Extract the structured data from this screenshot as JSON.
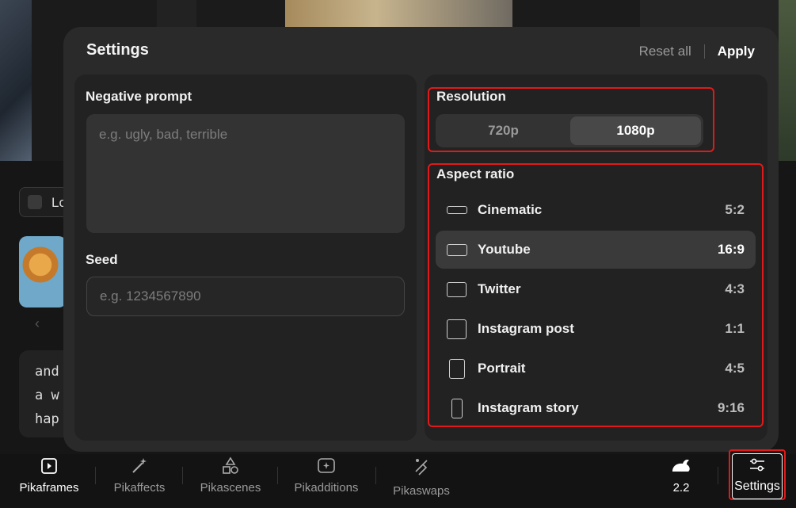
{
  "background": {
    "loop_label": "Lo",
    "prompt_lines": [
      "and",
      "a w",
      "hap"
    ]
  },
  "settings": {
    "title": "Settings",
    "reset_label": "Reset all",
    "apply_label": "Apply",
    "negative_prompt": {
      "label": "Negative prompt",
      "placeholder": "e.g. ugly, bad, terrible",
      "value": ""
    },
    "seed": {
      "label": "Seed",
      "placeholder": "e.g. 1234567890",
      "value": ""
    },
    "resolution": {
      "label": "Resolution",
      "options": [
        "720p",
        "1080p"
      ],
      "selected": "1080p"
    },
    "aspect_ratio": {
      "label": "Aspect ratio",
      "selected": "Youtube",
      "items": [
        {
          "name": "Cinematic",
          "ratio": "5:2",
          "icon": "wide-rectangle-icon"
        },
        {
          "name": "Youtube",
          "ratio": "16:9",
          "icon": "widescreen-rectangle-icon"
        },
        {
          "name": "Twitter",
          "ratio": "4:3",
          "icon": "landscape-rectangle-icon"
        },
        {
          "name": "Instagram post",
          "ratio": "1:1",
          "icon": "square-icon"
        },
        {
          "name": "Portrait",
          "ratio": "4:5",
          "icon": "portrait-rectangle-icon"
        },
        {
          "name": "Instagram story",
          "ratio": "9:16",
          "icon": "tall-rectangle-icon"
        }
      ]
    }
  },
  "toolbar": {
    "items": [
      {
        "label": "Pikaframes",
        "icon": "frame-play-icon"
      },
      {
        "label": "Pikaffects",
        "icon": "magic-wand-icon"
      },
      {
        "label": "Pikascenes",
        "icon": "shapes-icon"
      },
      {
        "label": "Pikadditions",
        "icon": "add-sparkle-icon"
      },
      {
        "label": "Pikaswaps",
        "icon": "swap-brush-icon"
      }
    ],
    "model_version": "2.2",
    "model_icon": "rabbit-icon",
    "settings_label": "Settings",
    "settings_icon": "sliders-icon"
  },
  "colors": {
    "modal_bg": "#2a2a2a",
    "card_bg": "#222222",
    "highlight": "#e01a1a",
    "selected_bg": "#3a3a3a"
  }
}
